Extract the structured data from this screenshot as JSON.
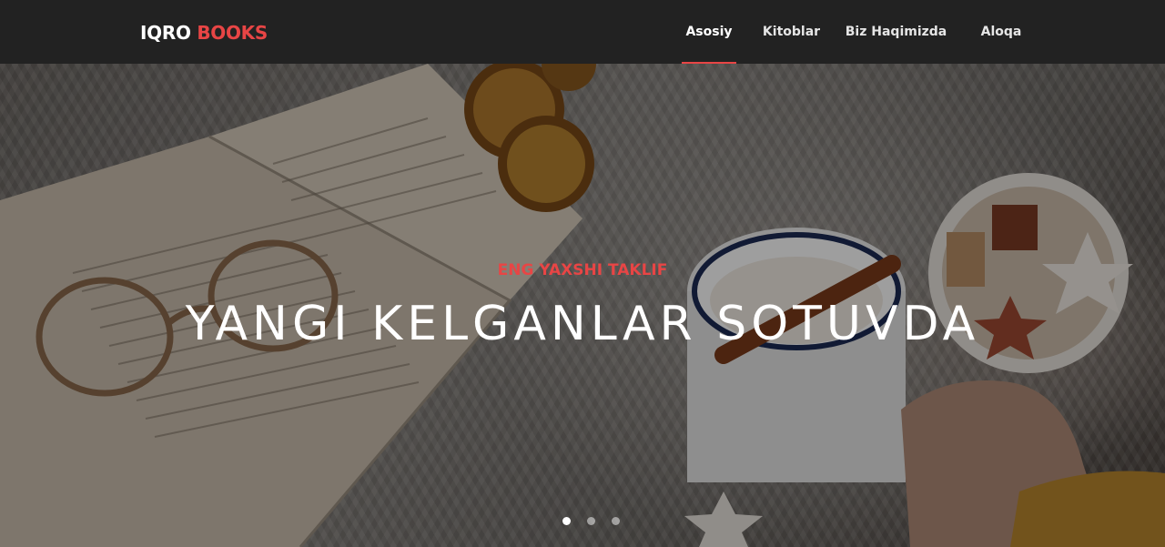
{
  "brand": {
    "part1": "IQRO",
    "part2": "BOOKS"
  },
  "nav": {
    "items": [
      {
        "label": "Asosiy",
        "active": true
      },
      {
        "label": "Kitoblar",
        "active": false
      },
      {
        "label": "Biz Haqimizda",
        "active": false
      },
      {
        "label": "Aloqa",
        "active": false
      }
    ]
  },
  "hero": {
    "kicker": "ENG YAXSHI TAKLIF",
    "title": "YANGI KELGANLAR SOTUVDA",
    "slides": {
      "count": 3,
      "active_index": 0
    }
  },
  "colors": {
    "accent": "#e84545",
    "navbar_bg": "#222222"
  }
}
